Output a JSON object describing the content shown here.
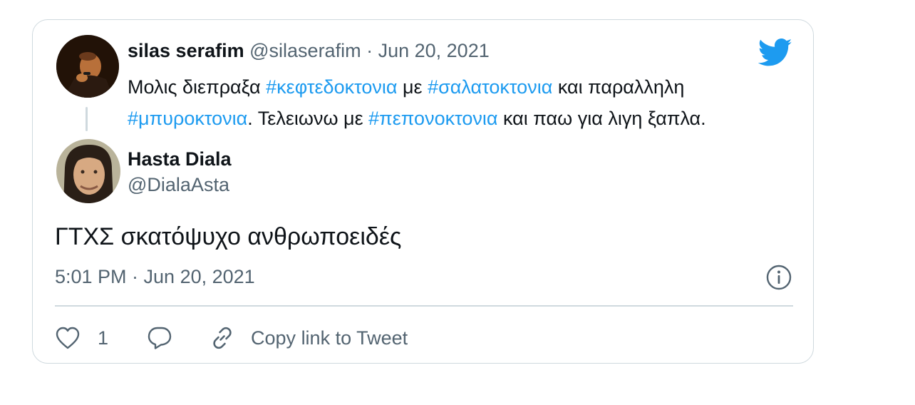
{
  "quoted_tweet": {
    "author_name": "silas serafim",
    "author_handle": "@silaserafim",
    "separator": "·",
    "date": "Jun 20, 2021",
    "text_parts": [
      {
        "text": "Μολις διεπραξα ",
        "hashtag": false
      },
      {
        "text": "#κεφτεδοκτονια",
        "hashtag": true
      },
      {
        "text": " με ",
        "hashtag": false
      },
      {
        "text": "#σαλατοκτονια",
        "hashtag": true
      },
      {
        "text": " και παραλληλη ",
        "hashtag": false
      },
      {
        "text": "#μπυροκτονια",
        "hashtag": true
      },
      {
        "text": ". Τελειωνω με ",
        "hashtag": false
      },
      {
        "text": "#πεπονοκτονια",
        "hashtag": true
      },
      {
        "text": " και παω για λιγη ξαπλα.",
        "hashtag": false
      }
    ],
    "icons": {
      "avatar": "avatar-silas",
      "brand": "twitter-bird-icon"
    }
  },
  "reply_tweet": {
    "author_name": "Hasta Diala",
    "author_handle": "@DialaAsta",
    "text": "ΓΤΧΣ σκατόψυχο ανθρωποειδές",
    "timestamp": "5:01 PM · Jun 20, 2021",
    "icons": {
      "info": "info-icon",
      "avatar": "avatar-hasta"
    }
  },
  "actions": {
    "like_count": "1",
    "copy_link_label": "Copy link to Tweet",
    "icons": {
      "like": "heart-icon",
      "reply": "reply-bubble-icon",
      "link": "link-icon"
    }
  },
  "colors": {
    "hashtag": "#1d9bf0",
    "secondary_text": "#536471",
    "primary_text": "#0f1419",
    "border": "#cfd9de",
    "brand": "#1d9bf0"
  }
}
